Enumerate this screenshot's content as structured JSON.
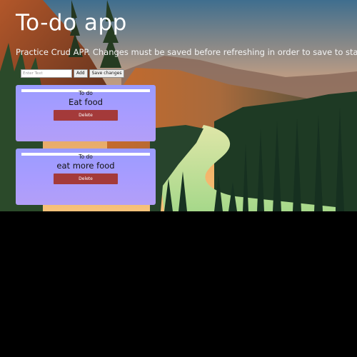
{
  "app": {
    "title": "To-do app",
    "subtitle": "Practice Crud APP. Changes must be saved before refreshing in order to save to state."
  },
  "add_bar": {
    "input_placeholder": "Enter Text",
    "input_value": "",
    "add_label": "Add",
    "save_label": "Save changes"
  },
  "todos": [
    {
      "heading": "To do",
      "text": "Eat food",
      "delete_label": "Delete"
    },
    {
      "heading": "To do",
      "text": "eat more food",
      "delete_label": "Delete"
    }
  ],
  "colors": {
    "card_gradient_top": "#9a9cff",
    "card_gradient_bottom": "#b39ff7",
    "delete_button": "#a43a3a",
    "page_background": "#000000"
  }
}
